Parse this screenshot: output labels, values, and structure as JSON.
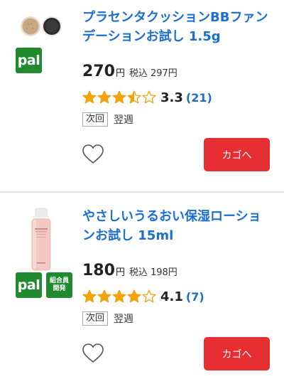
{
  "products": [
    {
      "title": "プラセンタクッションBBファンデーションお試し 1.5g",
      "price": "270",
      "yen": "円",
      "tax_label": "税込",
      "tax_price": "297円",
      "rating": 3.5,
      "rating_score": "3.3",
      "review_count": "(21)",
      "next_label": "次回",
      "delivery": "翌週",
      "badges": [
        "pal"
      ],
      "badge_pal": "pal",
      "cart_label": "カゴへ",
      "thumbnail_icon": "cushion-compact-icon"
    },
    {
      "title": "やさしいうるおい保湿ローションお試し 15ml",
      "price": "180",
      "yen": "円",
      "tax_label": "税込",
      "tax_price": "198円",
      "rating": 4.0,
      "rating_score": "4.1",
      "review_count": "(7)",
      "next_label": "次回",
      "delivery": "翌週",
      "badges": [
        "pal",
        "組合員開発"
      ],
      "badge_pal": "pal",
      "badge_coop_line1": "組合員",
      "badge_coop_line2": "開発",
      "cart_label": "カゴへ",
      "thumbnail_icon": "lotion-bottle-icon"
    }
  ],
  "colors": {
    "accent": "#1a6fd1",
    "cart": "#e62e33",
    "badge": "#1f8a2e",
    "star": "#f2a20c"
  }
}
